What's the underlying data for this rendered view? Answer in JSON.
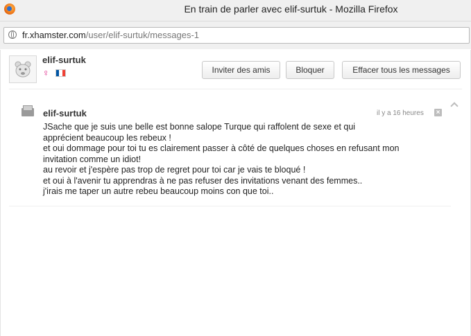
{
  "window": {
    "title": "En train de parler avec elif-surtuk - Mozilla Firefox",
    "url_host": "fr.xhamster.com",
    "url_path": "/user/elif-surtuk/messages-1"
  },
  "profile": {
    "username": "elif-surtuk",
    "gender_icon": "female-icon",
    "flag": "france-flag-icon",
    "flag_colors": [
      "#0055a4",
      "#ffffff",
      "#ef4135"
    ]
  },
  "actions": {
    "invite_label": "Inviter des amis",
    "block_label": "Bloquer",
    "clear_label": "Effacer tous les messages"
  },
  "message": {
    "sender": "elif-surtuk",
    "time": "il y a 16 heures",
    "lines": [
      "JSache que je suis une belle est bonne salope Turque qui raffolent de sexe et qui",
      "apprécient beaucoup les rebeux !",
      "et oui dommage pour toi tu es clairement passer à côté de quelques choses en refusant mon",
      "invitation comme un idiot!",
      "au revoir et j'espère pas trop de regret pour toi car je vais te bloqué !",
      "et oui à l'avenir tu apprendras à ne pas refuser des invitations venant des femmes..",
      "j'irais me taper un autre rebeu beaucoup moins con que toi.."
    ]
  }
}
